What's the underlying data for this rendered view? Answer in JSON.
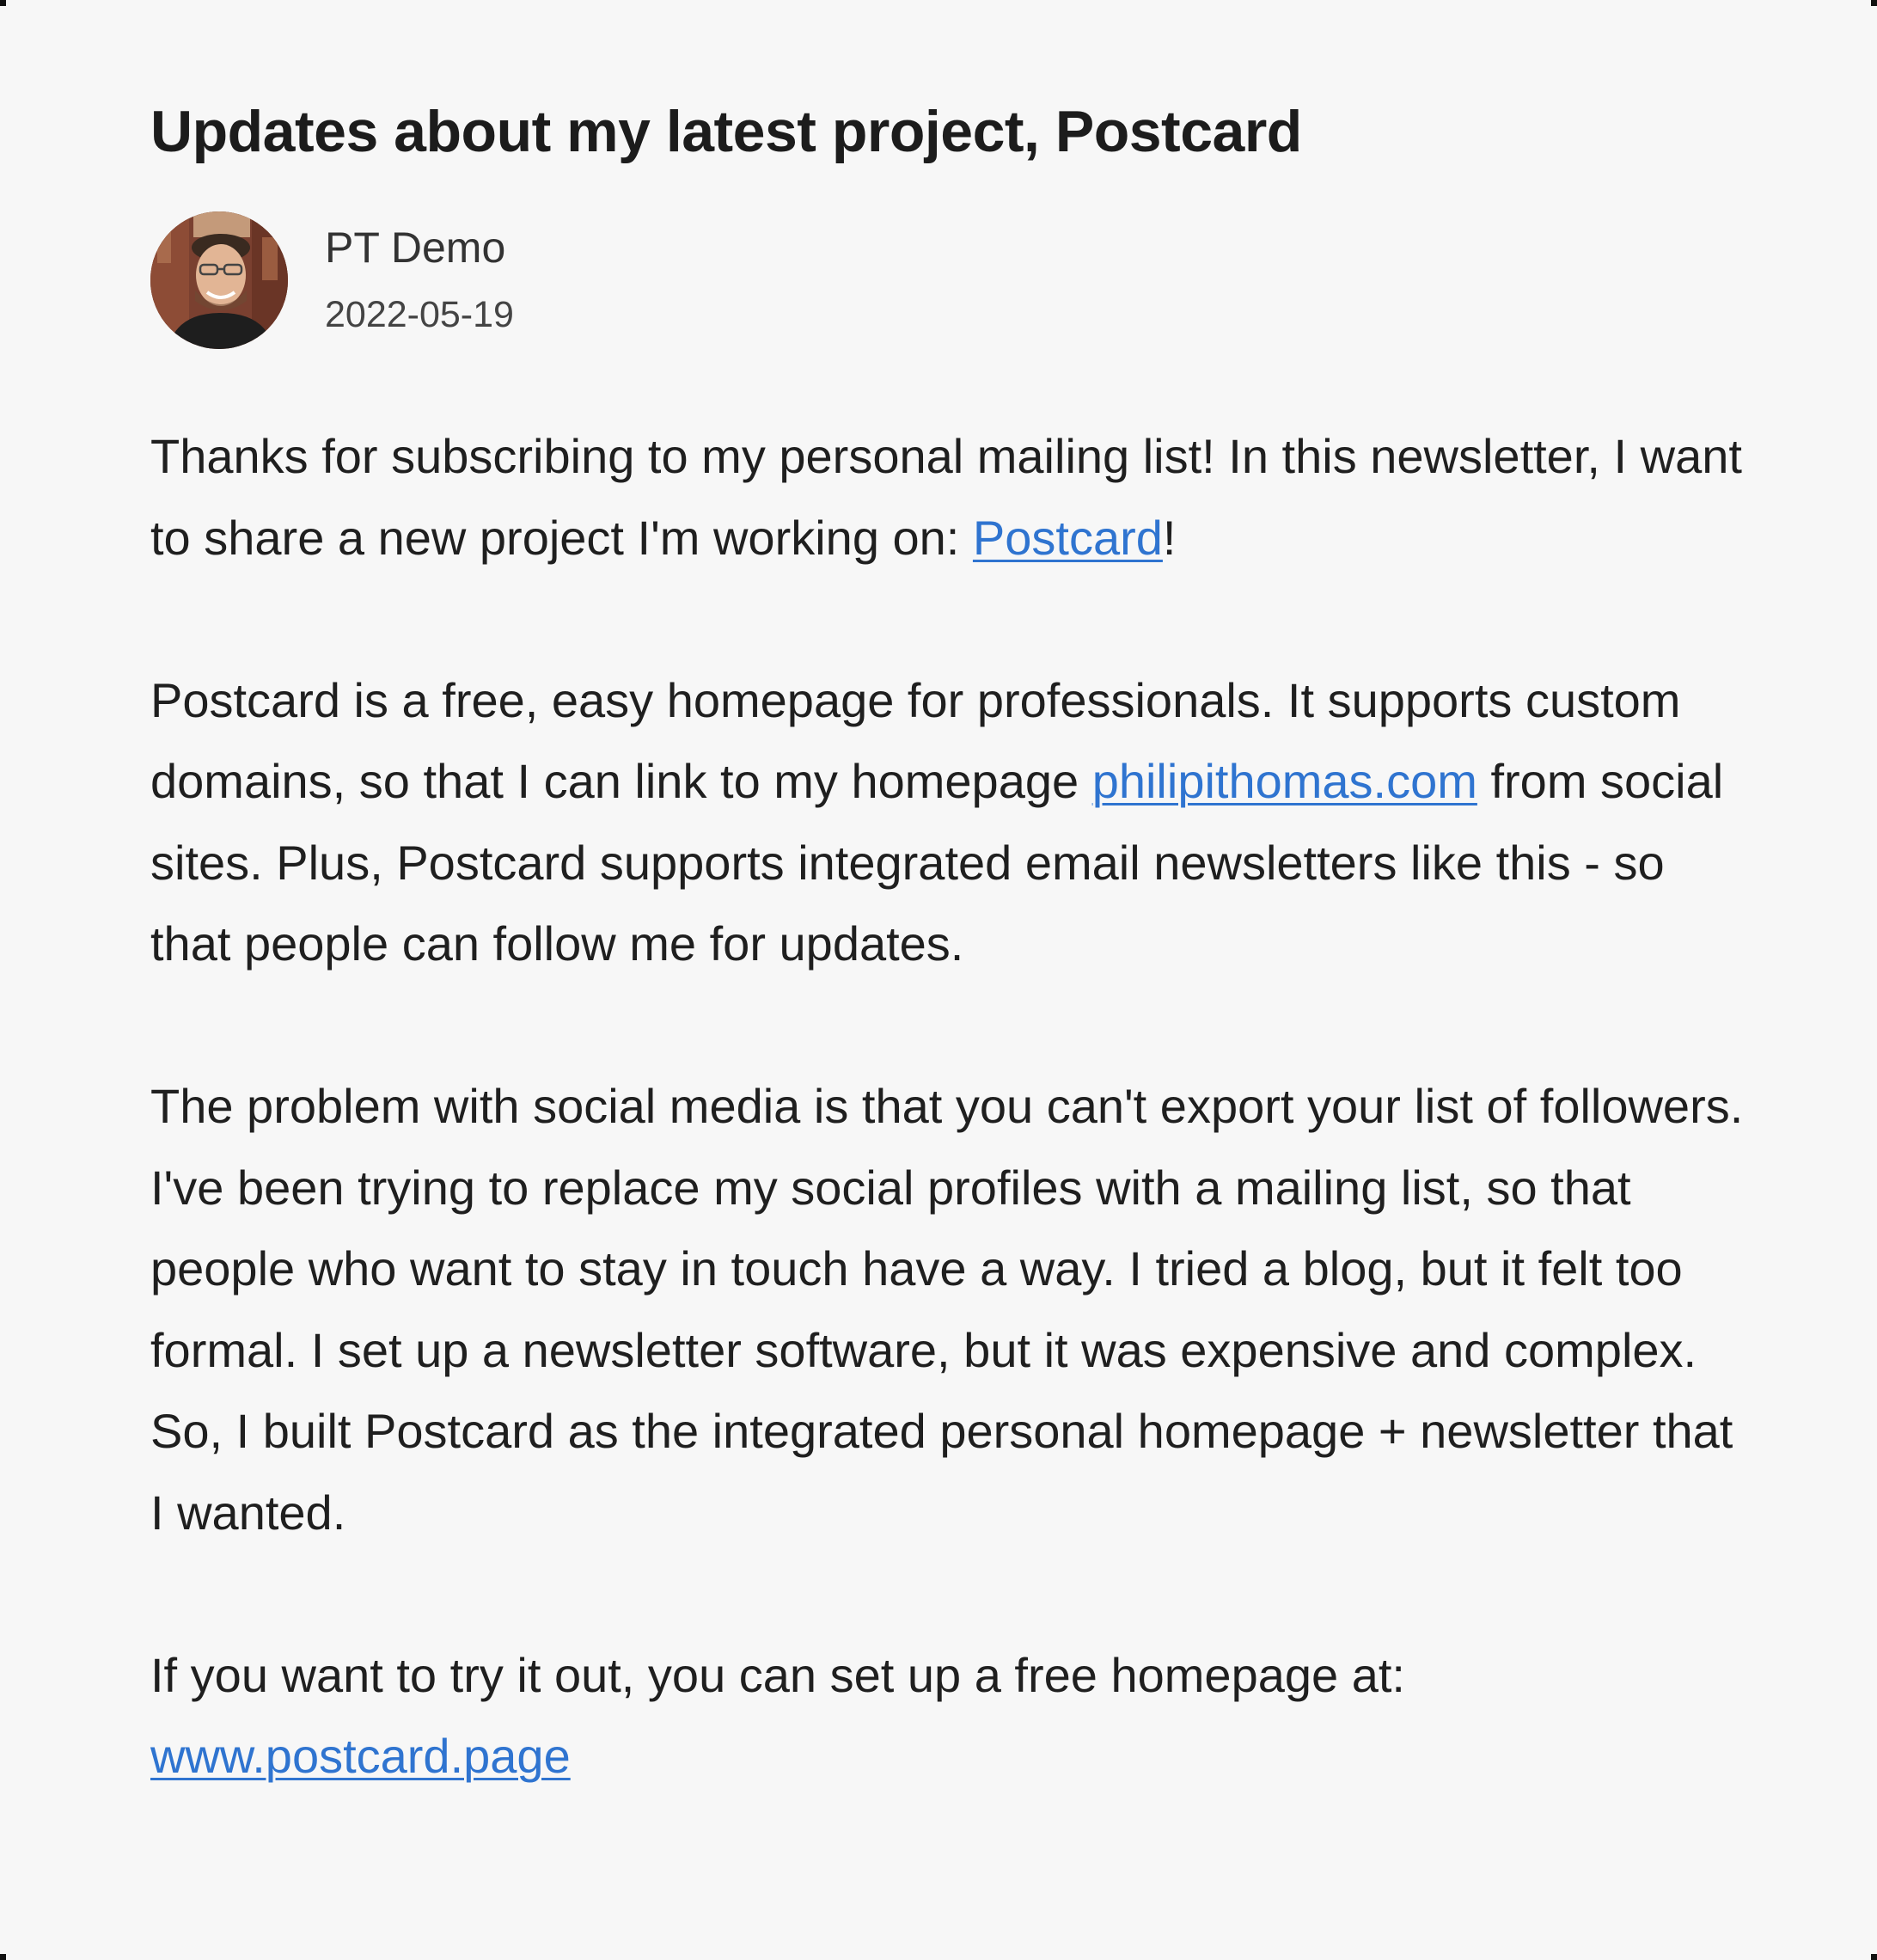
{
  "post": {
    "title": "Updates about my latest project, Postcard",
    "author": {
      "name": "PT Demo",
      "date": "2022-05-19",
      "avatar_icon": "person-photo-icon"
    },
    "paragraphs": [
      {
        "before": "Thanks for subscribing to my personal mailing list! In this newsletter, I want to share a new project I'm working on: ",
        "link": "Postcard",
        "after": "!"
      },
      {
        "before": "Postcard is a free, easy homepage for professionals. It supports custom domains, so that I can link to my homepage ",
        "link": "philipithomas.com",
        "after": " from social sites. Plus, Postcard supports integrated email newsletters like this - so that people can follow me for updates."
      },
      {
        "text": "The problem with social media is that you can't export your list of followers. I've been trying to replace my social profiles with a mailing list, so that people who want to stay in touch have a way. I tried a blog, but it felt too formal. I set up a newsletter software, but it was expensive and complex. So, I built Postcard as the integrated personal homepage + newsletter that I wanted."
      },
      {
        "before": "If you want to try it out, you can set up a free homepage at: ",
        "link": "www.postcard.page",
        "after": ""
      }
    ]
  },
  "colors": {
    "background": "#f7f7f7",
    "text": "#1f1f1f",
    "link": "#2f74d0"
  }
}
